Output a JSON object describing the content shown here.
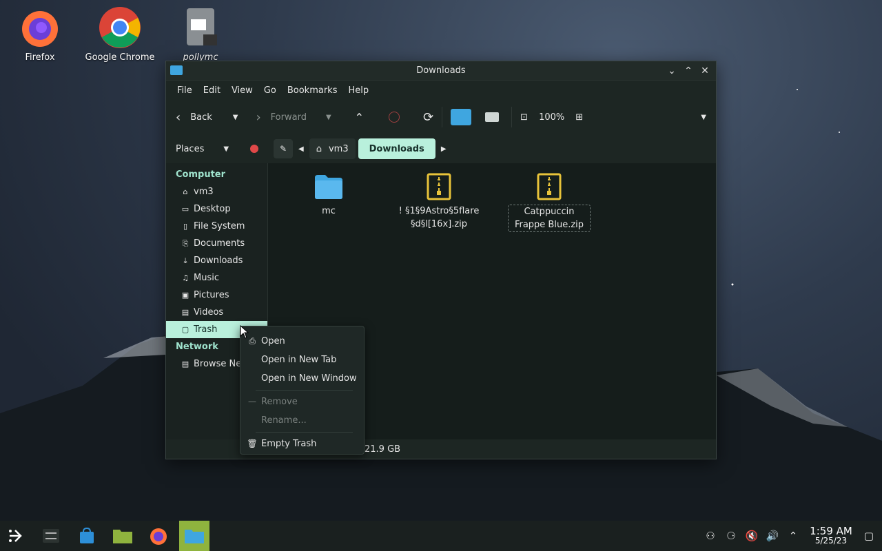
{
  "desktop": {
    "icons": [
      {
        "label": "Firefox"
      },
      {
        "label": "Google Chrome"
      },
      {
        "label": "pollymc"
      }
    ]
  },
  "window": {
    "title": "Downloads"
  },
  "menubar": [
    "File",
    "Edit",
    "View",
    "Go",
    "Bookmarks",
    "Help"
  ],
  "toolbar": {
    "back_label": "Back",
    "forward_label": "Forward",
    "zoom_label": "100%"
  },
  "places": {
    "header_label": "Places",
    "computer_label": "Computer",
    "network_label": "Network",
    "items": [
      {
        "label": "vm3",
        "icon": "home-icon"
      },
      {
        "label": "Desktop",
        "icon": "desktop-icon"
      },
      {
        "label": "File System",
        "icon": "drive-icon"
      },
      {
        "label": "Documents",
        "icon": "document-icon"
      },
      {
        "label": "Downloads",
        "icon": "download-icon"
      },
      {
        "label": "Music",
        "icon": "music-icon"
      },
      {
        "label": "Pictures",
        "icon": "picture-icon"
      },
      {
        "label": "Videos",
        "icon": "video-icon"
      },
      {
        "label": "Trash",
        "icon": "trash-icon"
      }
    ],
    "network_items": [
      {
        "label": "Browse Network",
        "icon": "network-icon"
      }
    ]
  },
  "breadcrumb": {
    "home": "vm3",
    "current": "Downloads"
  },
  "files": [
    {
      "name": "mc",
      "type": "folder"
    },
    {
      "name": "! §1§9Astro§5flare §d§l[16x].zip",
      "type": "zip"
    },
    {
      "name": "Catppuccin Frappe Blue.zip",
      "type": "zip"
    }
  ],
  "status": {
    "free_space": "21.9 GB"
  },
  "context_menu": {
    "items": [
      {
        "label": "Open",
        "enabled": true
      },
      {
        "label": "Open in New Tab",
        "enabled": true
      },
      {
        "label": "Open in New Window",
        "enabled": true
      },
      {
        "label": "Remove",
        "enabled": false
      },
      {
        "label": "Rename...",
        "enabled": false
      },
      {
        "label": "Empty Trash",
        "enabled": true
      }
    ]
  },
  "clock": {
    "time": "1:59 AM",
    "date": "5/25/23"
  },
  "colors": {
    "accent": "#b9f0dc",
    "folder": "#3fa6e0",
    "zip": "#e8c33a"
  }
}
